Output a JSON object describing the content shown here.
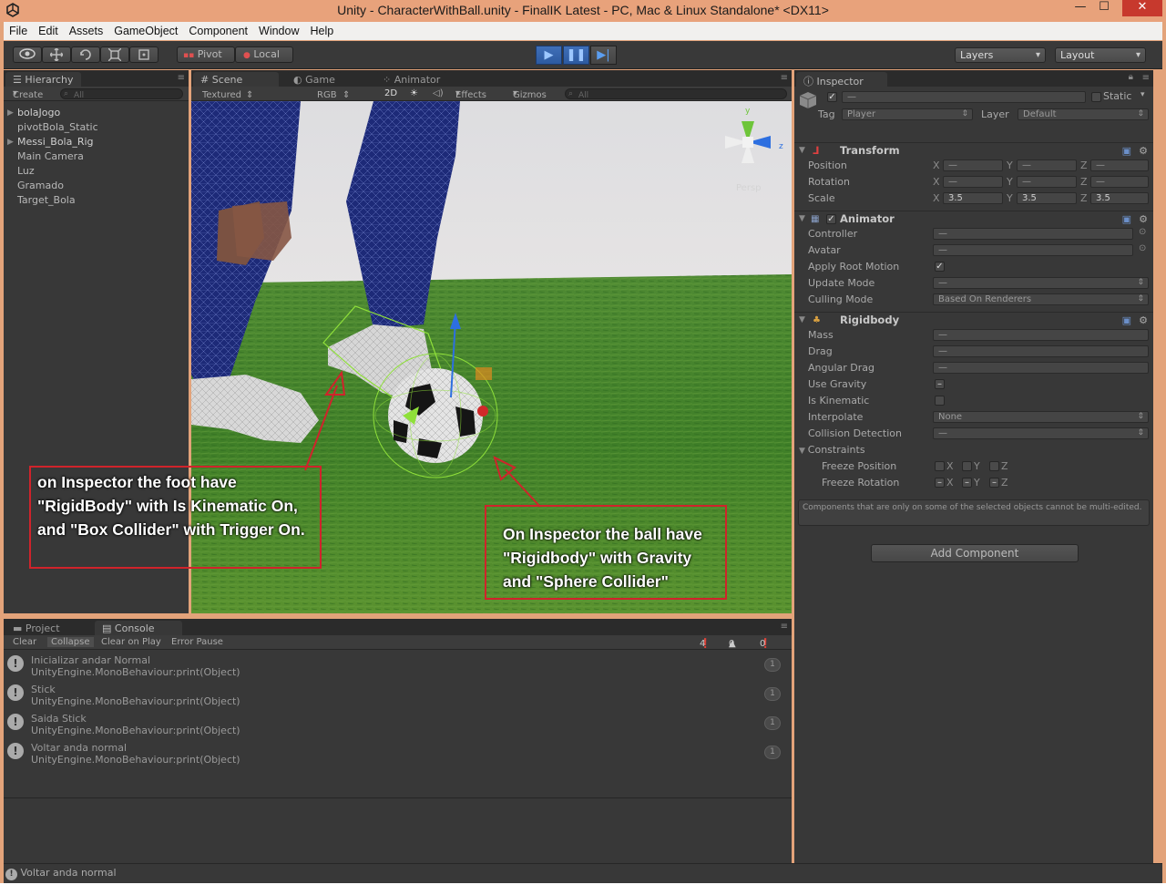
{
  "window": {
    "title": "Unity - CharacterWithBall.unity - FinalIK Latest - PC, Mac & Linux Standalone* <DX11>",
    "minimize": "—",
    "maximize": "☐",
    "close": "✕"
  },
  "menu": [
    "File",
    "Edit",
    "Assets",
    "GameObject",
    "Component",
    "Window",
    "Help"
  ],
  "toolbar": {
    "pivot": "Pivot",
    "local": "Local",
    "layers": "Layers",
    "layout": "Layout"
  },
  "hierarchy": {
    "tab": "Hierarchy",
    "create": "Create",
    "search_placeholder": "All",
    "items": [
      "bolaJogo",
      "pivotBola_Static",
      "Messi_Bola_Rig",
      "Main Camera",
      "Luz",
      "Gramado",
      "Target_Bola"
    ]
  },
  "scene": {
    "tabs": [
      "Scene",
      "Game",
      "Animator"
    ],
    "shading": "Textured",
    "render": "RGB",
    "mode2d": "2D",
    "effects": "Effects",
    "gizmos": "Gizmos",
    "search_placeholder": "All",
    "persp": "Persp",
    "gizmo_axes": {
      "y": "y",
      "z": "z"
    }
  },
  "annotations": {
    "foot": "on Inspector the foot have \"RigidBody\" with Is Kinematic On, and \"Box Collider\" with Trigger On.",
    "ball": "On Inspector the ball have \"Rigidbody\" with Gravity and \"Sphere Collider\""
  },
  "inspector": {
    "tab": "Inspector",
    "name": "—",
    "static": "Static",
    "tag_label": "Tag",
    "tag": "Player",
    "layer_label": "Layer",
    "layer": "Default",
    "transform": {
      "title": "Transform",
      "position": "Position",
      "rotation": "Rotation",
      "scale": "Scale",
      "x": "X",
      "y": "Y",
      "z": "Z",
      "pos": [
        "—",
        "—",
        "—"
      ],
      "rot": [
        "—",
        "—",
        "—"
      ],
      "scl": [
        "3.5",
        "3.5",
        "3.5"
      ]
    },
    "animator": {
      "title": "Animator",
      "controller": "Controller",
      "avatar": "Avatar",
      "apply_root": "Apply Root Motion",
      "update_mode": "Update Mode",
      "culling_mode": "Culling Mode",
      "controller_val": "—",
      "avatar_val": "—",
      "update_val": "—",
      "culling_val": "Based On Renderers"
    },
    "rigidbody": {
      "title": "Rigidbody",
      "mass": "Mass",
      "drag": "Drag",
      "angular": "Angular Drag",
      "gravity": "Use Gravity",
      "kinematic": "Is Kinematic",
      "interpolate": "Interpolate",
      "collision": "Collision Detection",
      "constraints": "Constraints",
      "freeze_pos": "Freeze Position",
      "freeze_rot": "Freeze Rotation",
      "mass_val": "—",
      "drag_val": "—",
      "angular_val": "—",
      "interp_val": "None",
      "coll_val": "—",
      "x": "X",
      "y": "Y",
      "z": "Z"
    },
    "notice": "Components that are only on some of the selected objects cannot be multi-edited.",
    "add_component": "Add Component"
  },
  "console": {
    "tabs": [
      "Project",
      "Console"
    ],
    "buttons": [
      "Clear",
      "Collapse",
      "Clear on Play",
      "Error Pause"
    ],
    "counts": {
      "log": "4",
      "warn": "0",
      "error": "0"
    },
    "rows": [
      {
        "t1": "Inicializar andar Normal",
        "t2": "UnityEngine.MonoBehaviour:print(Object)",
        "n": "1"
      },
      {
        "t1": "Stick",
        "t2": "UnityEngine.MonoBehaviour:print(Object)",
        "n": "1"
      },
      {
        "t1": "Saida Stick",
        "t2": "UnityEngine.MonoBehaviour:print(Object)",
        "n": "1"
      },
      {
        "t1": "Voltar anda normal",
        "t2": "UnityEngine.MonoBehaviour:print(Object)",
        "n": "1"
      }
    ]
  },
  "statusbar": "Voltar anda normal",
  "colors": {
    "annotation_border": "#d0232b",
    "play_blue": "#3f6fb8",
    "grass": "#3f7f28",
    "jersey": "#1d2a78"
  }
}
